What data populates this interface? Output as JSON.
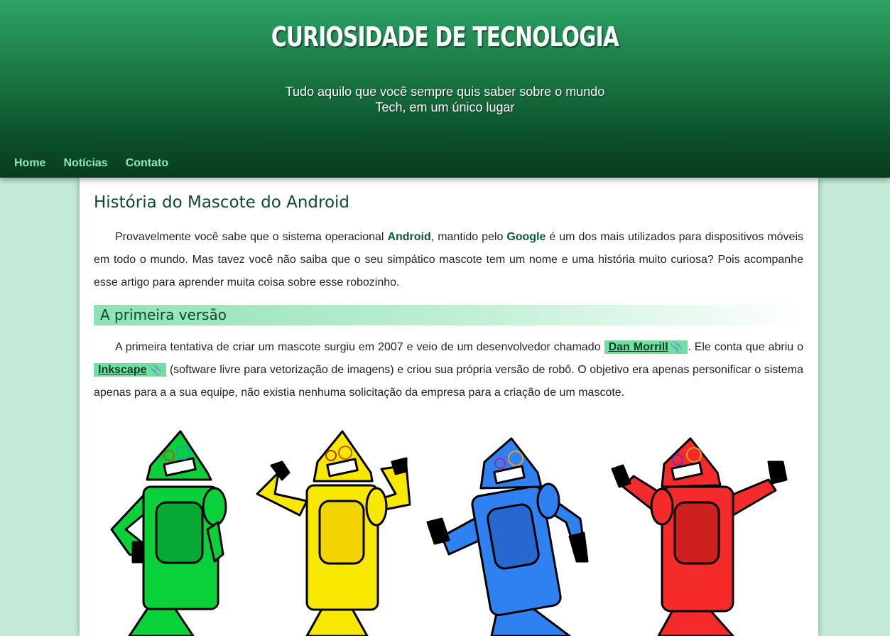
{
  "header": {
    "title": "CURIOSIDADE DE TECNOLOGIA",
    "subtitle_line1": "Tudo aquilo que você sempre quis saber sobre o mundo",
    "subtitle_line2": "Tech, em um único lugar"
  },
  "nav": [
    {
      "label": "Home"
    },
    {
      "label": "Notícias"
    },
    {
      "label": "Contato"
    }
  ],
  "article": {
    "title": "História do Mascote do Android",
    "intro": {
      "t1": "Provavelmente você sabe que o sistema operacional ",
      "b1": "Android",
      "t2": ", mantido pelo ",
      "b2": "Google",
      "t3": " é um dos mais utilizados para dispositivos móveis em todo o mundo. Mas tavez você não saiba que o seu simpático mascote tem um nome e uma história muito curiosa? Pois acompanhe esse artigo para aprender muita coisa sobre esse robozinho."
    },
    "section1": {
      "heading": "A primeira versão",
      "t1": "A primeira tentativa de criar um mascote surgiu em 2007 e veio de um desenvolvedor chamado ",
      "link1": "Dan Morrill",
      "t2": ". Ele conta que abriu o ",
      "link2": "Inkscape",
      "t3": " (software livre para vetorização de imagens) e criou sua própria versão de robô. O objetivo era apenas personificar o sistema apenas para a a sua equipe, não existia nenhuma solicitação da empresa para a criação de um mascote.",
      "link_icon": "paperclip-icon"
    },
    "image": {
      "robot_colors": [
        {
          "body": "#0ad03a",
          "panel": "#05a934"
        },
        {
          "body": "#f8e800",
          "panel": "#f2d500"
        },
        {
          "body": "#2f80f0",
          "panel": "#2667d0"
        },
        {
          "body": "#f52a2a",
          "panel": "#cf2020"
        }
      ]
    }
  }
}
